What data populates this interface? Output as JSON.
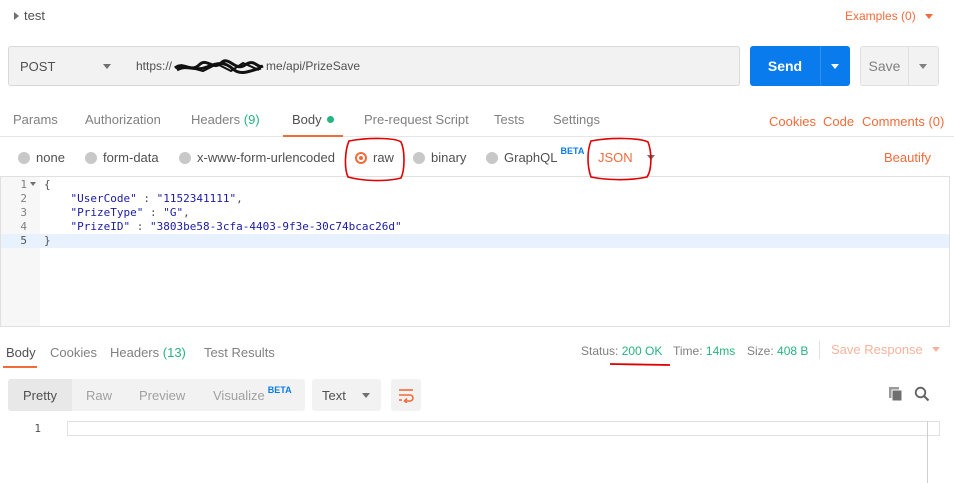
{
  "request": {
    "name": "test",
    "examples_label": "Examples (0)",
    "method": "POST",
    "url_prefix": "https://",
    "url_suffix": "me/api/PrizeSave",
    "send_label": "Send",
    "save_label": "Save"
  },
  "request_tabs": [
    {
      "label": "Params"
    },
    {
      "label": "Authorization"
    },
    {
      "label": "Headers",
      "count": "(9)"
    },
    {
      "label": "Body"
    },
    {
      "label": "Pre-request Script"
    },
    {
      "label": "Tests"
    },
    {
      "label": "Settings"
    }
  ],
  "request_links": {
    "cookies": "Cookies",
    "code": "Code",
    "comments": "Comments (0)"
  },
  "body_types": [
    {
      "label": "none"
    },
    {
      "label": "form-data"
    },
    {
      "label": "x-www-form-urlencoded"
    },
    {
      "label": "raw",
      "selected": true
    },
    {
      "label": "binary"
    },
    {
      "label": "GraphQL",
      "badge": "BETA"
    }
  ],
  "raw_language": "JSON",
  "beautify_label": "Beautify",
  "editor": {
    "line_numbers": [
      "1",
      "2",
      "3",
      "4",
      "5"
    ],
    "lines": [
      {
        "text": "{"
      },
      {
        "key": "\"UserCode\"",
        "sep": " : ",
        "value": "\"1152341111\"",
        "end": ","
      },
      {
        "key": "\"PrizeType\"",
        "sep": " : ",
        "value": "\"G\"",
        "end": ","
      },
      {
        "key": "\"PrizeID\"",
        "sep": " : ",
        "value": "\"3803be58-3cfa-4403-9f3e-30c74bcac26d\"",
        "end": ""
      },
      {
        "text": "}"
      }
    ]
  },
  "response_tabs": [
    {
      "label": "Body"
    },
    {
      "label": "Cookies"
    },
    {
      "label": "Headers",
      "count": "(13)"
    },
    {
      "label": "Test Results"
    }
  ],
  "response_status": {
    "status_label": "Status:",
    "status_value": "200 OK",
    "time_label": "Time:",
    "time_value": "14ms",
    "size_label": "Size:",
    "size_value": "408 B",
    "save_response": "Save Response"
  },
  "response_views": [
    {
      "label": "Pretty"
    },
    {
      "label": "Raw"
    },
    {
      "label": "Preview"
    },
    {
      "label": "Visualize",
      "badge": "BETA"
    }
  ],
  "response_format": "Text",
  "response_line_number": "1",
  "icons": {
    "wrap": "wrap-lines-icon",
    "copy": "copy-icon",
    "search": "search-icon"
  },
  "colors": {
    "accent": "#f26b3a",
    "primary": "#097bed",
    "success": "#26b47f",
    "annotation": "#e00000"
  }
}
